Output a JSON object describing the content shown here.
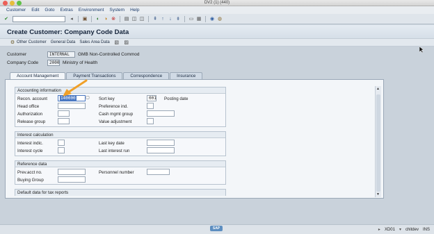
{
  "window": {
    "title": "DV2 (1) (440)"
  },
  "menu": [
    "Customer",
    "Edit",
    "Goto",
    "Extras",
    "Environment",
    "System",
    "Help"
  ],
  "screen": {
    "title": "Create Customer: Company Code Data"
  },
  "app_toolbar": {
    "other_customer": "Other Customer",
    "general_data": "General Data",
    "sales_area_data": "Sales Area Data"
  },
  "header": {
    "customer_label": "Customer",
    "customer_value": "INTERNAL",
    "customer_desc": "GMB Non-Controlled Commod",
    "company_code_label": "Company Code",
    "company_code_value": "2000",
    "company_code_desc": "Ministry of  Health"
  },
  "tabs": [
    "Account Management",
    "Payment Transactions",
    "Correspondence",
    "Insurance"
  ],
  "accounting": {
    "title": "Accounting information",
    "recon_label": "Recon. account",
    "recon_value": "140000",
    "sort_key_label": "Sort key",
    "sort_key_value": "001",
    "sort_key_desc": "Posting date",
    "head_office_label": "Head office",
    "preference_label": "Preference ind.",
    "authorization_label": "Authorization",
    "cash_mgmt_label": "Cash mgmt group",
    "release_group_label": "Release group",
    "value_adj_label": "Value adjustment"
  },
  "interest": {
    "title": "Interest calculation",
    "indic_label": "Interest indic.",
    "last_key_label": "Last key date",
    "cycle_label": "Interest cycle",
    "last_run_label": "Last interest run"
  },
  "reference": {
    "title": "Reference data",
    "prev_acct_label": "Prev.acct no.",
    "personnel_label": "Personnel number",
    "buying_group_label": "Buying Group"
  },
  "default_tax": {
    "title": "Default data for tax reports"
  },
  "status": {
    "transaction": "XD01",
    "user": "chitdev",
    "mode": "INS"
  },
  "colors": {
    "arrow": "#f0a028",
    "focus": "#4a78c2"
  }
}
